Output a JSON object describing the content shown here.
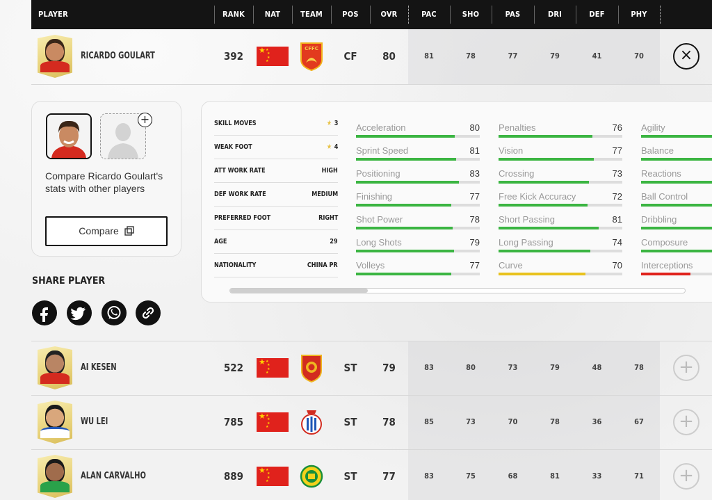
{
  "header": {
    "player": "PLAYER",
    "rank": "RANK",
    "nat": "NAT",
    "team": "TEAM",
    "pos": "POS",
    "ovr": "OVR",
    "pac": "PAC",
    "sho": "SHO",
    "pas": "PAS",
    "dri": "DRI",
    "def": "DEF",
    "phy": "PHY"
  },
  "players": [
    {
      "name": "RICARDO GOULART",
      "rank": "392",
      "pos": "CF",
      "ovr": "80",
      "pac": "81",
      "sho": "78",
      "pas": "77",
      "dri": "79",
      "def": "41",
      "phy": "70",
      "crest": "CFFC",
      "action_icon": "close-icon",
      "action": "×"
    },
    {
      "name": "AI KESEN",
      "rank": "522",
      "pos": "ST",
      "ovr": "79",
      "pac": "83",
      "sho": "80",
      "pas": "73",
      "dri": "79",
      "def": "48",
      "phy": "78",
      "action_icon": "plus-icon",
      "action": "+"
    },
    {
      "name": "WU LEI",
      "rank": "785",
      "pos": "ST",
      "ovr": "78",
      "pac": "85",
      "sho": "73",
      "pas": "70",
      "dri": "78",
      "def": "36",
      "phy": "67",
      "action_icon": "plus-icon",
      "action": "+"
    },
    {
      "name": "ALAN CARVALHO",
      "rank": "889",
      "pos": "ST",
      "ovr": "77",
      "pac": "83",
      "sho": "75",
      "pas": "68",
      "dri": "81",
      "def": "33",
      "phy": "71",
      "action_icon": "plus-icon",
      "action": "+"
    }
  ],
  "compare": {
    "add_label": "+",
    "text": "Compare Ricardo Goulart's stats with other players",
    "button_label": "Compare",
    "button_icon": "copy-icon"
  },
  "share": {
    "title": "SHARE PLAYER",
    "icons": [
      "facebook-icon",
      "twitter-icon",
      "whatsapp-icon",
      "link-icon"
    ],
    "glyphs": [
      "f",
      "t",
      "w",
      "∞"
    ]
  },
  "info": [
    {
      "label": "SKILL MOVES",
      "value": "3",
      "star": "★"
    },
    {
      "label": "WEAK FOOT",
      "value": "4",
      "star": "★"
    },
    {
      "label": "ATT WORK RATE",
      "value": "HIGH"
    },
    {
      "label": "DEF WORK RATE",
      "value": "MEDIUM"
    },
    {
      "label": "PREFERRED FOOT",
      "value": "RIGHT"
    },
    {
      "label": "AGE",
      "value": "29"
    },
    {
      "label": "NATIONALITY",
      "value": "CHINA PR"
    }
  ],
  "attributes": {
    "col1": [
      {
        "name": "Acceleration",
        "value": "80",
        "level": 0.8,
        "color": "#3bb542"
      },
      {
        "name": "Sprint Speed",
        "value": "81",
        "level": 0.81,
        "color": "#3bb542"
      },
      {
        "name": "Positioning",
        "value": "83",
        "level": 0.83,
        "color": "#3bb542"
      },
      {
        "name": "Finishing",
        "value": "77",
        "level": 0.77,
        "color": "#3bb542"
      },
      {
        "name": "Shot Power",
        "value": "78",
        "level": 0.78,
        "color": "#3bb542"
      },
      {
        "name": "Long Shots",
        "value": "79",
        "level": 0.79,
        "color": "#3bb542"
      },
      {
        "name": "Volleys",
        "value": "77",
        "level": 0.77,
        "color": "#3bb542"
      }
    ],
    "col2": [
      {
        "name": "Penalties",
        "value": "76",
        "level": 0.76,
        "color": "#3bb542"
      },
      {
        "name": "Vision",
        "value": "77",
        "level": 0.77,
        "color": "#3bb542"
      },
      {
        "name": "Crossing",
        "value": "73",
        "level": 0.73,
        "color": "#3bb542"
      },
      {
        "name": "Free Kick Accuracy",
        "value": "72",
        "level": 0.72,
        "color": "#3bb542"
      },
      {
        "name": "Short Passing",
        "value": "81",
        "level": 0.81,
        "color": "#3bb542"
      },
      {
        "name": "Long Passing",
        "value": "74",
        "level": 0.74,
        "color": "#3bb542"
      },
      {
        "name": "Curve",
        "value": "70",
        "level": 0.7,
        "color": "#e8c21e"
      }
    ],
    "col3": [
      {
        "name": "Agility",
        "level": 0.8,
        "color": "#3bb542"
      },
      {
        "name": "Balance",
        "level": 0.8,
        "color": "#3bb542"
      },
      {
        "name": "Reactions",
        "level": 0.8,
        "color": "#3bb542"
      },
      {
        "name": "Ball Control",
        "level": 0.8,
        "color": "#3bb542"
      },
      {
        "name": "Dribbling",
        "level": 0.8,
        "color": "#3bb542"
      },
      {
        "name": "Composure",
        "level": 0.8,
        "color": "#3bb542"
      },
      {
        "name": "Interceptions",
        "level": 0.4,
        "color": "#e0221c"
      }
    ]
  }
}
